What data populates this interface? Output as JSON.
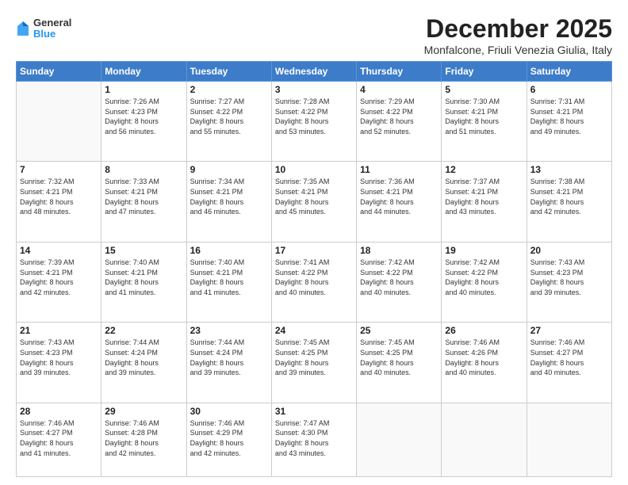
{
  "logo": {
    "general": "General",
    "blue": "Blue"
  },
  "header": {
    "month": "December 2025",
    "location": "Monfalcone, Friuli Venezia Giulia, Italy"
  },
  "weekdays": [
    "Sunday",
    "Monday",
    "Tuesday",
    "Wednesday",
    "Thursday",
    "Friday",
    "Saturday"
  ],
  "weeks": [
    [
      {
        "day": "",
        "info": ""
      },
      {
        "day": "1",
        "info": "Sunrise: 7:26 AM\nSunset: 4:23 PM\nDaylight: 8 hours\nand 56 minutes."
      },
      {
        "day": "2",
        "info": "Sunrise: 7:27 AM\nSunset: 4:22 PM\nDaylight: 8 hours\nand 55 minutes."
      },
      {
        "day": "3",
        "info": "Sunrise: 7:28 AM\nSunset: 4:22 PM\nDaylight: 8 hours\nand 53 minutes."
      },
      {
        "day": "4",
        "info": "Sunrise: 7:29 AM\nSunset: 4:22 PM\nDaylight: 8 hours\nand 52 minutes."
      },
      {
        "day": "5",
        "info": "Sunrise: 7:30 AM\nSunset: 4:21 PM\nDaylight: 8 hours\nand 51 minutes."
      },
      {
        "day": "6",
        "info": "Sunrise: 7:31 AM\nSunset: 4:21 PM\nDaylight: 8 hours\nand 49 minutes."
      }
    ],
    [
      {
        "day": "7",
        "info": "Sunrise: 7:32 AM\nSunset: 4:21 PM\nDaylight: 8 hours\nand 48 minutes."
      },
      {
        "day": "8",
        "info": "Sunrise: 7:33 AM\nSunset: 4:21 PM\nDaylight: 8 hours\nand 47 minutes."
      },
      {
        "day": "9",
        "info": "Sunrise: 7:34 AM\nSunset: 4:21 PM\nDaylight: 8 hours\nand 46 minutes."
      },
      {
        "day": "10",
        "info": "Sunrise: 7:35 AM\nSunset: 4:21 PM\nDaylight: 8 hours\nand 45 minutes."
      },
      {
        "day": "11",
        "info": "Sunrise: 7:36 AM\nSunset: 4:21 PM\nDaylight: 8 hours\nand 44 minutes."
      },
      {
        "day": "12",
        "info": "Sunrise: 7:37 AM\nSunset: 4:21 PM\nDaylight: 8 hours\nand 43 minutes."
      },
      {
        "day": "13",
        "info": "Sunrise: 7:38 AM\nSunset: 4:21 PM\nDaylight: 8 hours\nand 42 minutes."
      }
    ],
    [
      {
        "day": "14",
        "info": "Sunrise: 7:39 AM\nSunset: 4:21 PM\nDaylight: 8 hours\nand 42 minutes."
      },
      {
        "day": "15",
        "info": "Sunrise: 7:40 AM\nSunset: 4:21 PM\nDaylight: 8 hours\nand 41 minutes."
      },
      {
        "day": "16",
        "info": "Sunrise: 7:40 AM\nSunset: 4:21 PM\nDaylight: 8 hours\nand 41 minutes."
      },
      {
        "day": "17",
        "info": "Sunrise: 7:41 AM\nSunset: 4:22 PM\nDaylight: 8 hours\nand 40 minutes."
      },
      {
        "day": "18",
        "info": "Sunrise: 7:42 AM\nSunset: 4:22 PM\nDaylight: 8 hours\nand 40 minutes."
      },
      {
        "day": "19",
        "info": "Sunrise: 7:42 AM\nSunset: 4:22 PM\nDaylight: 8 hours\nand 40 minutes."
      },
      {
        "day": "20",
        "info": "Sunrise: 7:43 AM\nSunset: 4:23 PM\nDaylight: 8 hours\nand 39 minutes."
      }
    ],
    [
      {
        "day": "21",
        "info": "Sunrise: 7:43 AM\nSunset: 4:23 PM\nDaylight: 8 hours\nand 39 minutes."
      },
      {
        "day": "22",
        "info": "Sunrise: 7:44 AM\nSunset: 4:24 PM\nDaylight: 8 hours\nand 39 minutes."
      },
      {
        "day": "23",
        "info": "Sunrise: 7:44 AM\nSunset: 4:24 PM\nDaylight: 8 hours\nand 39 minutes."
      },
      {
        "day": "24",
        "info": "Sunrise: 7:45 AM\nSunset: 4:25 PM\nDaylight: 8 hours\nand 39 minutes."
      },
      {
        "day": "25",
        "info": "Sunrise: 7:45 AM\nSunset: 4:25 PM\nDaylight: 8 hours\nand 40 minutes."
      },
      {
        "day": "26",
        "info": "Sunrise: 7:46 AM\nSunset: 4:26 PM\nDaylight: 8 hours\nand 40 minutes."
      },
      {
        "day": "27",
        "info": "Sunrise: 7:46 AM\nSunset: 4:27 PM\nDaylight: 8 hours\nand 40 minutes."
      }
    ],
    [
      {
        "day": "28",
        "info": "Sunrise: 7:46 AM\nSunset: 4:27 PM\nDaylight: 8 hours\nand 41 minutes."
      },
      {
        "day": "29",
        "info": "Sunrise: 7:46 AM\nSunset: 4:28 PM\nDaylight: 8 hours\nand 42 minutes."
      },
      {
        "day": "30",
        "info": "Sunrise: 7:46 AM\nSunset: 4:29 PM\nDaylight: 8 hours\nand 42 minutes."
      },
      {
        "day": "31",
        "info": "Sunrise: 7:47 AM\nSunset: 4:30 PM\nDaylight: 8 hours\nand 43 minutes."
      },
      {
        "day": "",
        "info": ""
      },
      {
        "day": "",
        "info": ""
      },
      {
        "day": "",
        "info": ""
      }
    ]
  ]
}
